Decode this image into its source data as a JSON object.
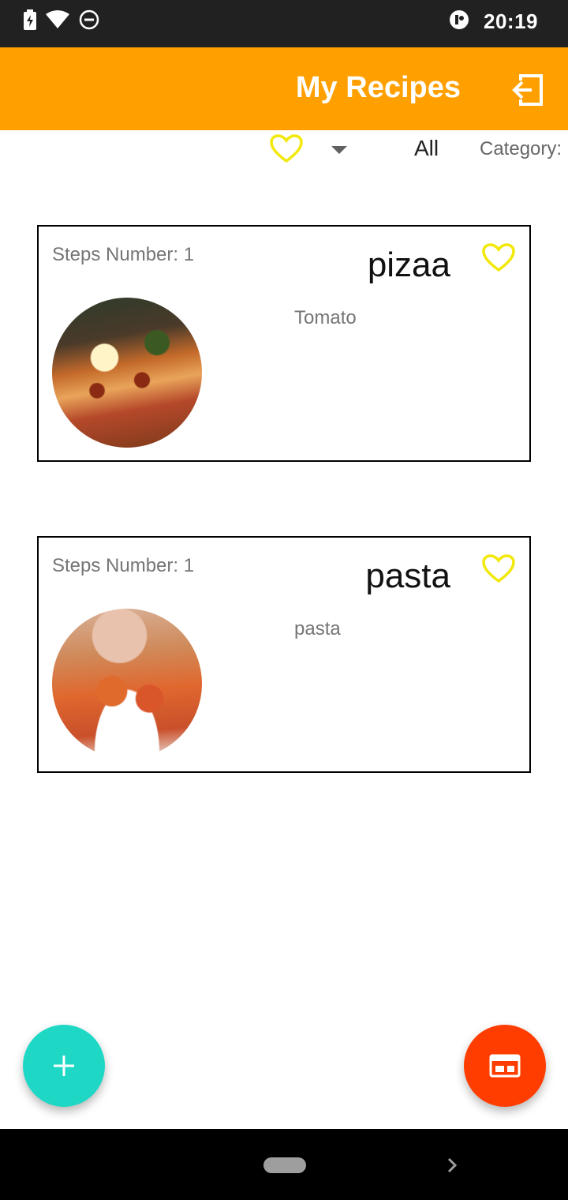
{
  "status_bar": {
    "time": "20:19",
    "icons_left": [
      "battery-charging-icon",
      "wifi-icon",
      "do-not-disturb-icon"
    ],
    "icons_right": [
      "app-notification-icon"
    ]
  },
  "app_bar": {
    "title": "My Recipes",
    "background": "#FFA000",
    "action_icon": "logout-icon"
  },
  "filter": {
    "favorite_icon": "heart-outline-icon",
    "dropdown_icon": "arrow-drop-down-icon",
    "selected": "All",
    "label": "Category:"
  },
  "recipes": [
    {
      "name": "pizaa",
      "steps_label": "Steps Number: 1",
      "ingredient": "Tomato",
      "favorite_icon": "heart-outline-icon",
      "image": "pizza-photo"
    },
    {
      "name": "pasta",
      "steps_label": "Steps Number: 1",
      "ingredient": "pasta",
      "favorite_icon": "heart-outline-icon",
      "image": "pasta-photo"
    }
  ],
  "fab": {
    "add_icon": "plus-icon",
    "add_color": "#1ED8C5",
    "view_icon": "view-card-icon",
    "view_color": "#FF3D00"
  },
  "nav_bar": {
    "icons": [
      "home-pill",
      "back-chevron-icon"
    ]
  }
}
